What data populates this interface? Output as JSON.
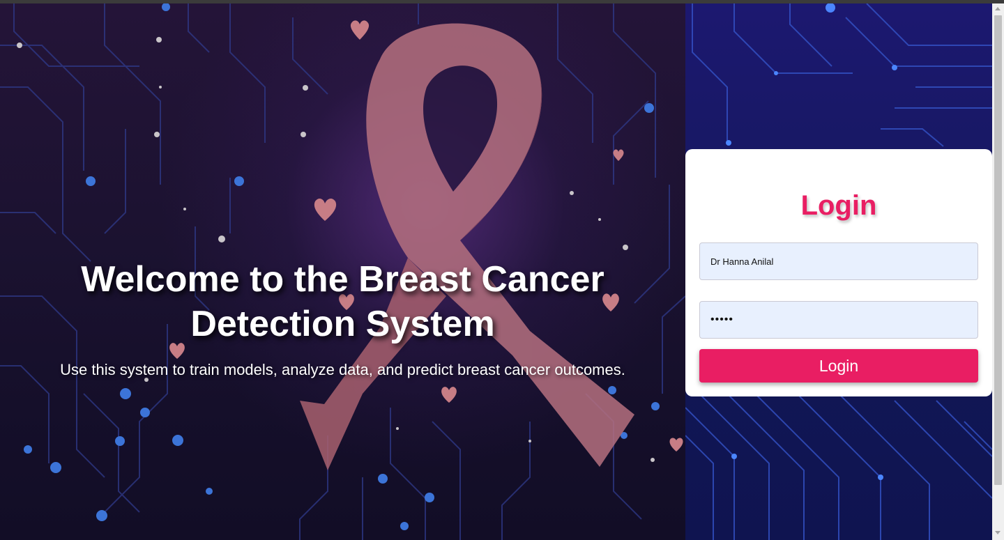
{
  "hero": {
    "title": "Welcome to the Breast Cancer Detection System",
    "subtitle": "Use this system to train models, analyze data, and predict breast cancer outcomes.",
    "background_image": "pink-awareness-ribbon-circuit-board-hearts"
  },
  "login": {
    "title": "Login",
    "username_value": "Dr Hanna Anilal",
    "password_value": "•••••",
    "button_label": "Login"
  },
  "colors": {
    "accent": "#e91e63",
    "input_bg": "#e8f0fe",
    "hero_bg": "#1b1230",
    "side_bg": "#161860"
  }
}
